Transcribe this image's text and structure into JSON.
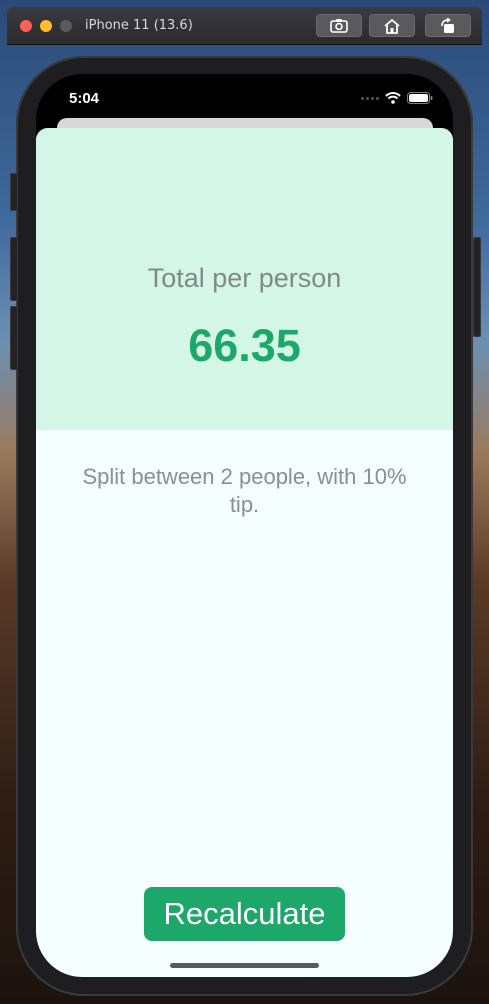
{
  "simulator": {
    "title": "iPhone 11 (13.6)",
    "buttons": [
      "screenshot-icon",
      "home-icon",
      "rotate-icon"
    ]
  },
  "status_bar": {
    "time": "5:04",
    "icons": [
      "signal-icon",
      "wifi-icon",
      "battery-icon"
    ]
  },
  "result": {
    "total_label": "Total per person",
    "total_value": "66.35",
    "settings_text": "Split between 2 people, with 10% tip.",
    "recalculate_label": "Recalculate"
  },
  "colors": {
    "accent": "#1ea76a",
    "top_panel": "#d3f6e7",
    "background": "#f5fffd",
    "secondary_text": "#808b88"
  }
}
